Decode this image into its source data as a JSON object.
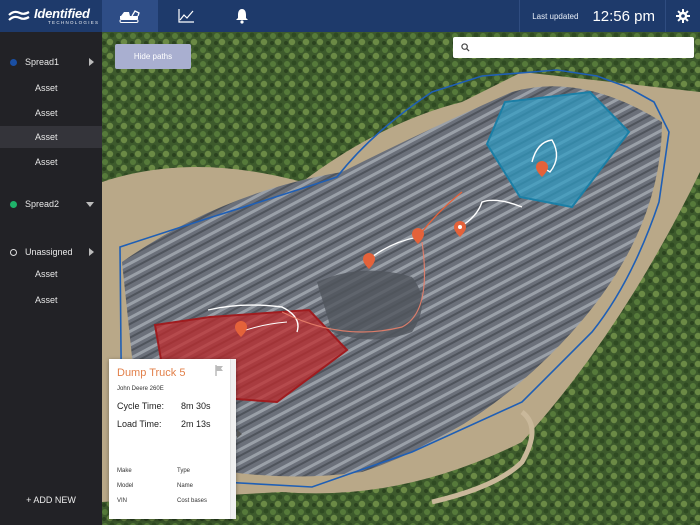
{
  "header": {
    "logo_main": "Identified",
    "logo_sub": "TECHNOLOGIES",
    "tabs": [
      {
        "icon": "excavator-icon",
        "active": true
      },
      {
        "icon": "line-chart-icon",
        "active": false
      },
      {
        "icon": "bell-icon",
        "active": false
      }
    ],
    "last_updated_label": "Last updated",
    "time": "12:56 pm",
    "settings_icon": "gear-icon"
  },
  "sidebar": {
    "groups": [
      {
        "name": "Spread1",
        "color": "#1a4fa3",
        "expanded": false,
        "items": [
          "Asset",
          "Asset",
          "Asset",
          "Asset"
        ],
        "selected_index": 2
      },
      {
        "name": "Spread2",
        "color": "#1fb36a",
        "expanded": true,
        "items": []
      },
      {
        "name": "Unassigned",
        "color": "hollow",
        "expanded": false,
        "items": [
          "Asset",
          "Asset"
        ]
      }
    ],
    "add_new": "+ ADD NEW"
  },
  "map": {
    "hide_paths_label": "Hide paths",
    "search_placeholder": "",
    "colors": {
      "zone_blue": "#2c9cc6",
      "zone_red": "#c0282a",
      "boundary": "#1f5fb5",
      "marker": "#e4623a"
    }
  },
  "asset_card": {
    "title": "Dump Truck 5",
    "subtitle": "John Deere 260E",
    "cycle_time_label": "Cycle Time:",
    "cycle_time_value": "8m 30s",
    "load_time_label": "Load Time:",
    "load_time_value": "2m 13s",
    "details": [
      "Make",
      "Type",
      "Model",
      "Name",
      "VIN",
      "Cost bases"
    ]
  }
}
